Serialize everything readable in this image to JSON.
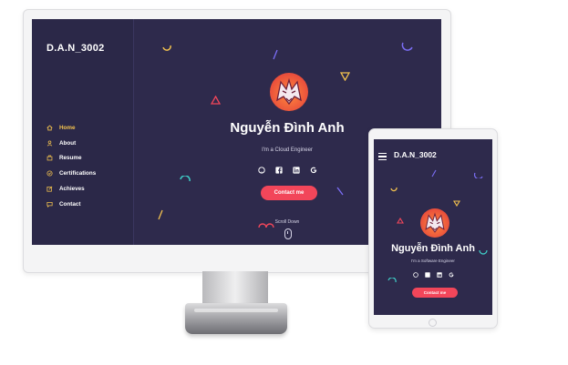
{
  "desktop": {
    "brand": "D.A.N_3002",
    "nav": [
      {
        "label": "Home",
        "icon": "home-icon",
        "active": true
      },
      {
        "label": "About",
        "icon": "user-icon",
        "active": false
      },
      {
        "label": "Resume",
        "icon": "resume-icon",
        "active": false
      },
      {
        "label": "Certifications",
        "icon": "certificate-icon",
        "active": false
      },
      {
        "label": "Achieves",
        "icon": "edit-icon",
        "active": false
      },
      {
        "label": "Contact",
        "icon": "chat-icon",
        "active": false
      }
    ],
    "hero": {
      "name": "Nguyễn Đình Anh",
      "role": "I'm a Cloud Engineer",
      "contact_label": "Contact me",
      "scroll_label": "Scroll Down",
      "socials": [
        "github-icon",
        "facebook-icon",
        "linkedin-icon",
        "google-icon"
      ]
    }
  },
  "tablet": {
    "brand": "D.A.N_3002",
    "hero": {
      "name": "Nguyễn Đình Anh",
      "role": "I'm a Software Engineer",
      "contact_label": "Contact me"
    }
  },
  "colors": {
    "background": "#2e2a4c",
    "sidebar": "#2b2848",
    "accent_active": "#f2c14e",
    "button": "#f2465a"
  }
}
